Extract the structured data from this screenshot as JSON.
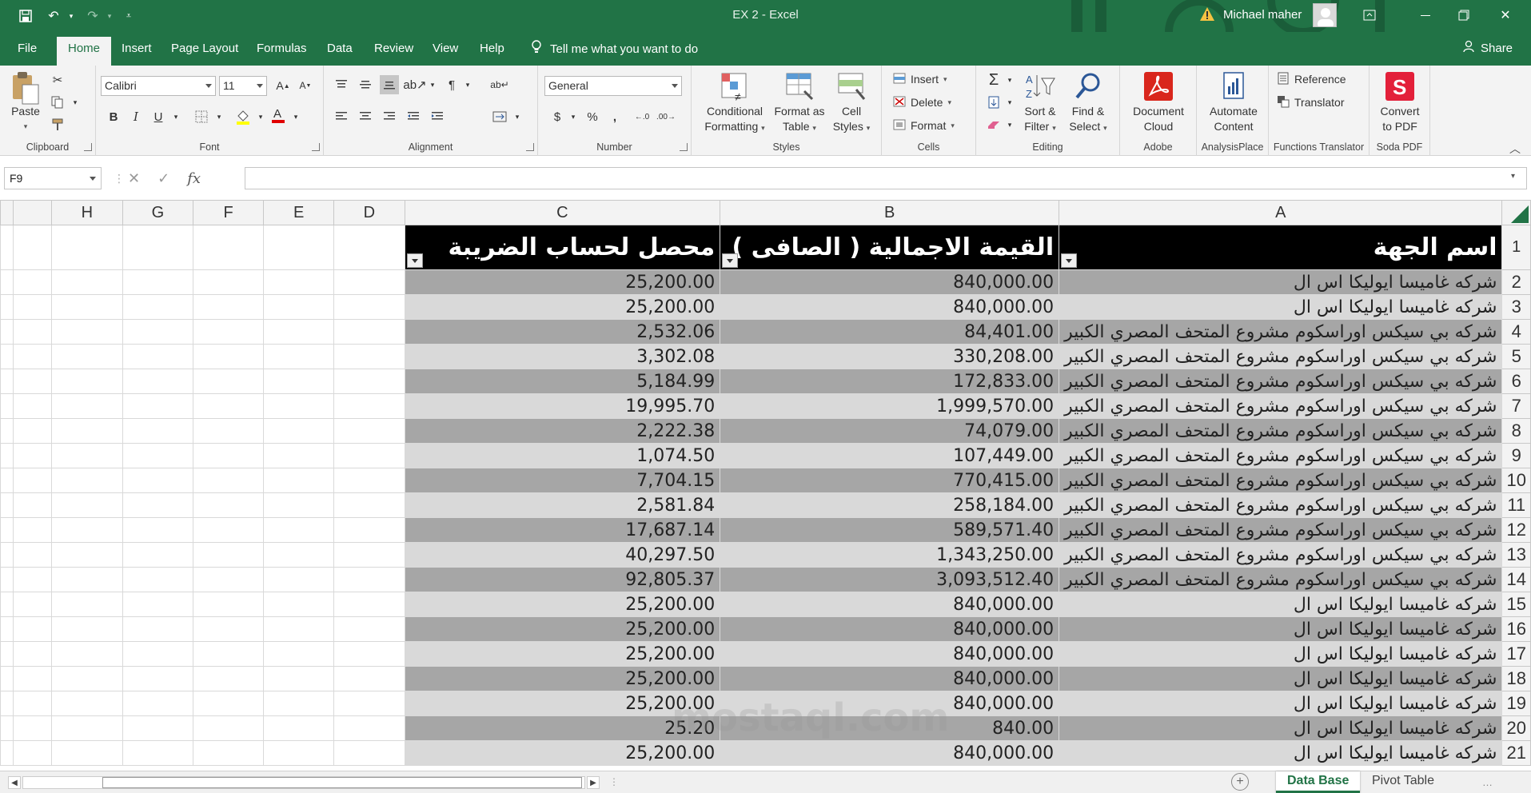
{
  "window": {
    "title": "EX 2  -  Excel",
    "user": "Michael maher",
    "brand_color": "#217346"
  },
  "ribbon_tabs": [
    {
      "label": "File",
      "active": false
    },
    {
      "label": "Home",
      "active": true
    },
    {
      "label": "Insert",
      "active": false
    },
    {
      "label": "Page Layout",
      "active": false
    },
    {
      "label": "Formulas",
      "active": false
    },
    {
      "label": "Data",
      "active": false
    },
    {
      "label": "Review",
      "active": false
    },
    {
      "label": "View",
      "active": false
    },
    {
      "label": "Help",
      "active": false
    }
  ],
  "tell_me": "Tell me what you want to do",
  "share": "Share",
  "ribbon": {
    "clipboard": {
      "label": "Clipboard",
      "paste": "Paste"
    },
    "font": {
      "label": "Font",
      "name": "Calibri",
      "size": "11"
    },
    "alignment": {
      "label": "Alignment"
    },
    "number": {
      "label": "Number",
      "format": "General"
    },
    "styles": {
      "label": "Styles",
      "conditional_1": "Conditional",
      "conditional_2": "Formatting",
      "format_table_1": "Format as",
      "format_table_2": "Table",
      "cell_styles_1": "Cell",
      "cell_styles_2": "Styles"
    },
    "cells": {
      "label": "Cells",
      "insert": "Insert",
      "delete": "Delete",
      "format": "Format"
    },
    "editing": {
      "label": "Editing",
      "sort_1": "Sort &",
      "sort_2": "Filter",
      "find_1": "Find &",
      "find_2": "Select"
    },
    "adobe": {
      "label": "Adobe",
      "doc_1": "Document",
      "doc_2": "Cloud"
    },
    "analysis": {
      "label": "AnalysisPlace",
      "auto_1": "Automate",
      "auto_2": "Content"
    },
    "functions": {
      "label": "Functions Translator",
      "reference": "Reference",
      "translator": "Translator"
    },
    "soda": {
      "label": "Soda PDF",
      "conv_1": "Convert",
      "conv_2": "to PDF"
    }
  },
  "formula_bar": {
    "name_box": "F9",
    "fx": "fx",
    "formula": ""
  },
  "columns": {
    "H": "H",
    "G": "G",
    "F": "F",
    "E": "E",
    "D": "D",
    "C": "C",
    "B": "B",
    "A": "A"
  },
  "table": {
    "headers": {
      "a": "اسم الجهة",
      "b": "القيمة الاجمالية ( الصافى )",
      "c": "محصل لحساب الضريبة"
    },
    "rows": [
      {
        "n": "2",
        "a": "شركه غاميسا ايوليكا اس ال",
        "b": "840,000.00",
        "c": "25,200.00"
      },
      {
        "n": "3",
        "a": "شركه غاميسا ايوليكا اس ال",
        "b": "840,000.00",
        "c": "25,200.00"
      },
      {
        "n": "4",
        "a": "شركه بي سيكس اوراسكوم مشروع المتحف المصري الكبير",
        "b": "84,401.00",
        "c": "2,532.06"
      },
      {
        "n": "5",
        "a": "شركه بي سيكس اوراسكوم مشروع المتحف المصري الكبير",
        "b": "330,208.00",
        "c": "3,302.08"
      },
      {
        "n": "6",
        "a": "شركه بي سيكس اوراسكوم مشروع المتحف المصري الكبير",
        "b": "172,833.00",
        "c": "5,184.99"
      },
      {
        "n": "7",
        "a": "شركه بي سيكس اوراسكوم مشروع المتحف المصري الكبير",
        "b": "1,999,570.00",
        "c": "19,995.70"
      },
      {
        "n": "8",
        "a": "شركه بي سيكس اوراسكوم مشروع المتحف المصري الكبير",
        "b": "74,079.00",
        "c": "2,222.38"
      },
      {
        "n": "9",
        "a": "شركه بي سيكس اوراسكوم مشروع المتحف المصري الكبير",
        "b": "107,449.00",
        "c": "1,074.50"
      },
      {
        "n": "10",
        "a": "شركه بي سيكس اوراسكوم مشروع المتحف المصري الكبير",
        "b": "770,415.00",
        "c": "7,704.15"
      },
      {
        "n": "11",
        "a": "شركه بي سيكس اوراسكوم مشروع المتحف المصري الكبير",
        "b": "258,184.00",
        "c": "2,581.84"
      },
      {
        "n": "12",
        "a": "شركه بي سيكس اوراسكوم مشروع المتحف المصري الكبير",
        "b": "589,571.40",
        "c": "17,687.14"
      },
      {
        "n": "13",
        "a": "شركه بي سيكس اوراسكوم مشروع المتحف المصري الكبير",
        "b": "1,343,250.00",
        "c": "40,297.50"
      },
      {
        "n": "14",
        "a": "شركه بي سيكس اوراسكوم مشروع المتحف المصري الكبير",
        "b": "3,093,512.40",
        "c": "92,805.37"
      },
      {
        "n": "15",
        "a": "شركه غاميسا ايوليكا اس ال",
        "b": "840,000.00",
        "c": "25,200.00"
      },
      {
        "n": "16",
        "a": "شركه غاميسا ايوليكا اس ال",
        "b": "840,000.00",
        "c": "25,200.00"
      },
      {
        "n": "17",
        "a": "شركه غاميسا ايوليكا اس ال",
        "b": "840,000.00",
        "c": "25,200.00"
      },
      {
        "n": "18",
        "a": "شركه غاميسا ايوليكا اس ال",
        "b": "840,000.00",
        "c": "25,200.00"
      },
      {
        "n": "19",
        "a": "شركه غاميسا ايوليكا اس ال",
        "b": "840,000.00",
        "c": "25,200.00"
      },
      {
        "n": "20",
        "a": "شركه غاميسا ايوليكا اس ال",
        "b": "840.00",
        "c": "25.20"
      },
      {
        "n": "21",
        "a": "شركه غاميسا ايوليكا اس ال",
        "b": "840,000.00",
        "c": "25,200.00"
      }
    ],
    "header_row_number": "1"
  },
  "sheets": [
    {
      "label": "Data Base",
      "active": true
    },
    {
      "label": "Pivot Table",
      "active": false
    }
  ],
  "watermark": "mostaql.com"
}
